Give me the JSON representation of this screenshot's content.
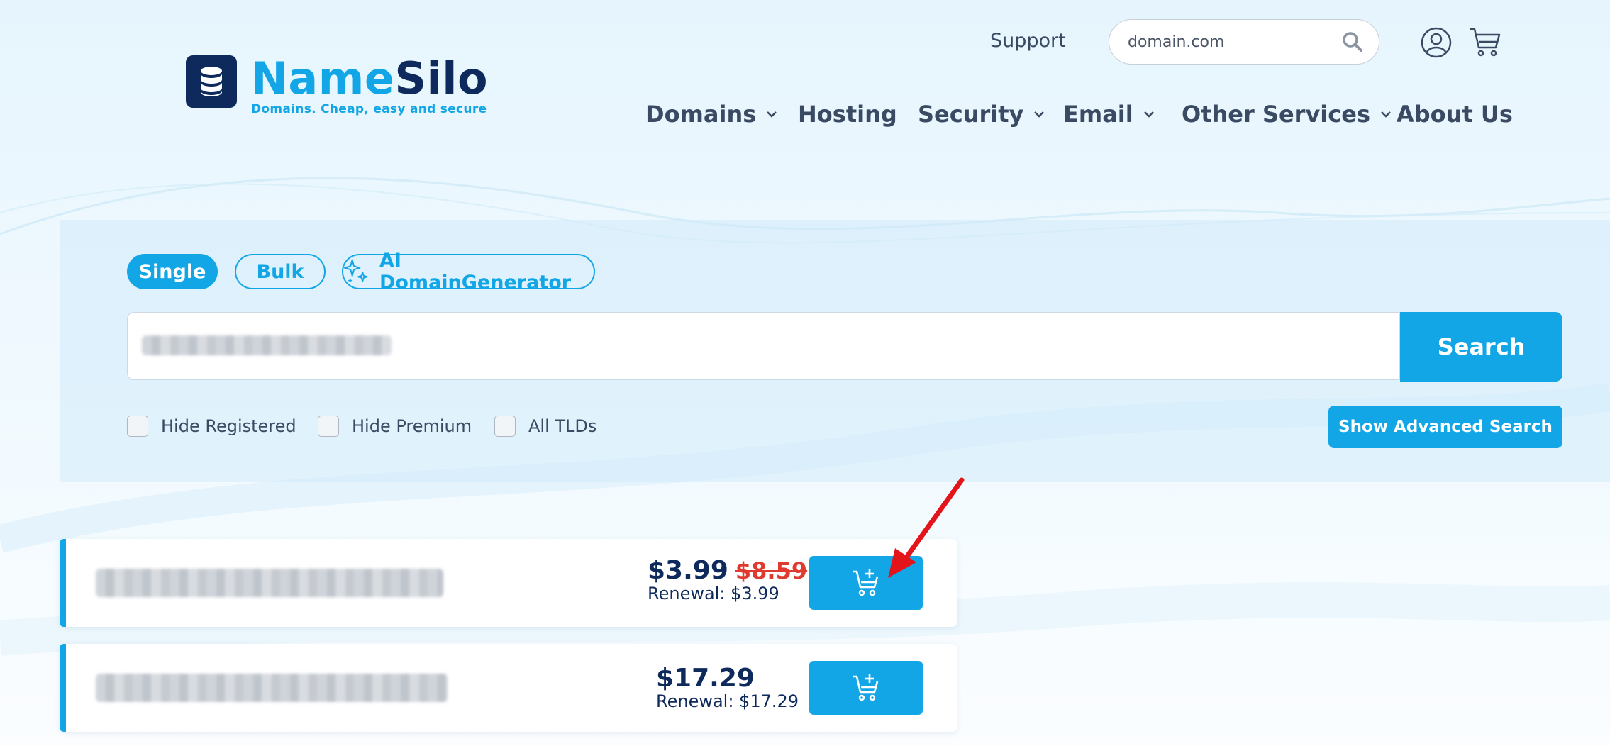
{
  "brand": {
    "name_part1": "Name",
    "name_part2": "Silo",
    "tagline": "Domains. Cheap, easy and secure"
  },
  "header": {
    "support_label": "Support",
    "search_placeholder": "domain.com",
    "icons": [
      "search-icon",
      "user-icon",
      "cart-icon"
    ]
  },
  "nav": {
    "items": [
      {
        "label": "Domains",
        "dropdown": true
      },
      {
        "label": "Hosting",
        "dropdown": false
      },
      {
        "label": "Security",
        "dropdown": true
      },
      {
        "label": "Email",
        "dropdown": true
      },
      {
        "label": "Other Services",
        "dropdown": true
      },
      {
        "label": "About Us",
        "dropdown": false
      }
    ]
  },
  "search_panel": {
    "tabs": [
      {
        "label": "Single",
        "active": true
      },
      {
        "label": "Bulk",
        "active": false
      },
      {
        "label": "AI DomainGenerator",
        "active": false,
        "icon": "sparkle-icon"
      }
    ],
    "query_value": "",
    "search_button": "Search",
    "filters": [
      {
        "label": "Hide Registered",
        "checked": false
      },
      {
        "label": "Hide Premium",
        "checked": false
      },
      {
        "label": "All TLDs",
        "checked": false
      }
    ],
    "advanced_button": "Show Advanced Search"
  },
  "results": [
    {
      "domain": "",
      "price": "$3.99",
      "old_price": "$8.59",
      "renewal": "Renewal: $3.99"
    },
    {
      "domain": "",
      "price": "$17.29",
      "old_price": "",
      "renewal": "Renewal: $17.29"
    }
  ],
  "colors": {
    "brand_blue": "#12a6e6",
    "navy": "#0e2a5c",
    "strike_red": "#e03a2e",
    "annotation_red": "#e3151b"
  }
}
